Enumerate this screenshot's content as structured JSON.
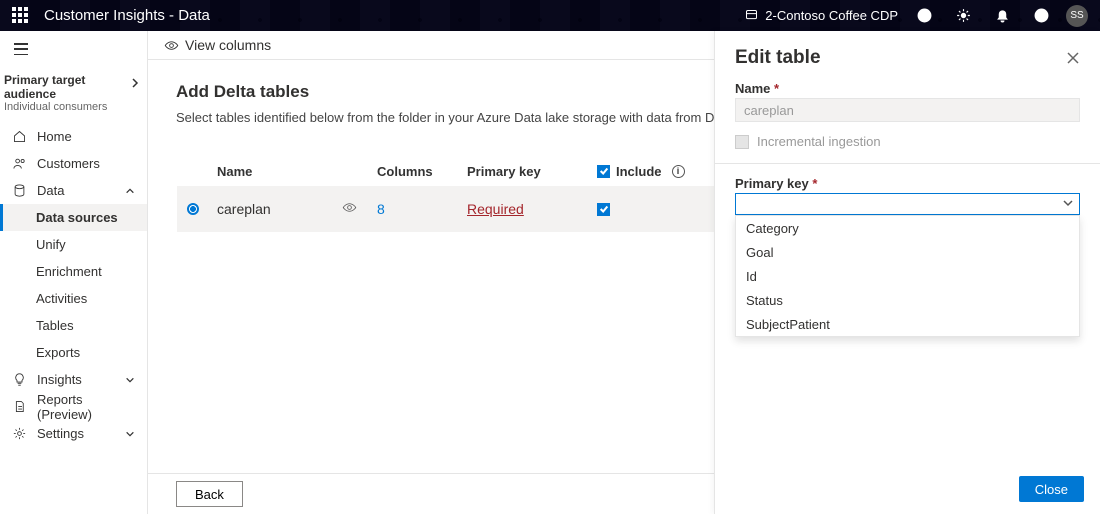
{
  "header": {
    "app_title": "Customer Insights - Data",
    "environment_label": "2-Contoso Coffee CDP",
    "avatar_initials": "SS"
  },
  "nav": {
    "audience_heading": "Primary target audience",
    "audience_sub": "Individual consumers",
    "home": "Home",
    "customers": "Customers",
    "data": "Data",
    "data_sources": "Data sources",
    "unify": "Unify",
    "enrichment": "Enrichment",
    "activities": "Activities",
    "tables": "Tables",
    "exports": "Exports",
    "insights": "Insights",
    "reports": "Reports (Preview)",
    "settings": "Settings"
  },
  "toolbar": {
    "view_columns": "View columns"
  },
  "page": {
    "title": "Add Delta tables",
    "description": "Select tables identified below from the folder in your Azure Data lake storage with data from Delta tables.",
    "columns": {
      "name": "Name",
      "columns": "Columns",
      "pk": "Primary key",
      "include": "Include"
    },
    "rows": [
      {
        "name": "careplan",
        "columns": "8",
        "pk": "Required",
        "included": true
      }
    ],
    "back": "Back"
  },
  "panel": {
    "title": "Edit table",
    "name_label": "Name",
    "name_value": "careplan",
    "incremental_label": "Incremental ingestion",
    "pk_label": "Primary key",
    "pk_options": [
      "Category",
      "Goal",
      "Id",
      "Status",
      "SubjectPatient"
    ],
    "close": "Close"
  }
}
